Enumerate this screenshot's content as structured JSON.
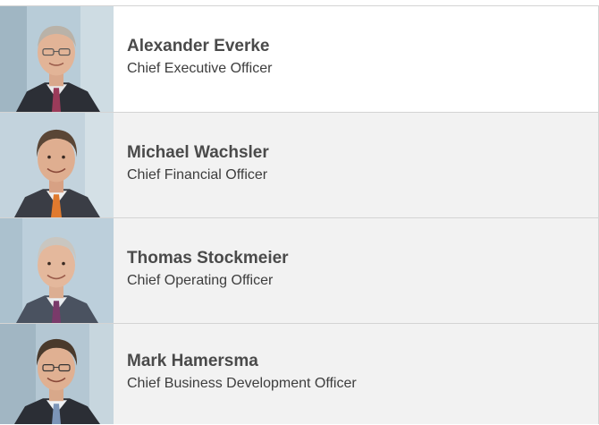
{
  "members": [
    {
      "name": "Alexander Everke",
      "title": "Chief Executive Officer",
      "photo_icon": "portrait-photo",
      "tie_color": "#9b3b5a",
      "hair_color": "#b9b2a8"
    },
    {
      "name": "Michael Wachsler",
      "title": "Chief Financial Officer",
      "photo_icon": "portrait-photo",
      "tie_color": "#e07a2e",
      "hair_color": "#5a4636"
    },
    {
      "name": "Thomas Stockmeier",
      "title": "Chief Operating Officer",
      "photo_icon": "portrait-photo",
      "tie_color": "#7a3a6a",
      "hair_color": "#c9c6c0"
    },
    {
      "name": "Mark Hamersma",
      "title": "Chief Business Development Officer",
      "photo_icon": "portrait-photo",
      "tie_color": "#7c95b8",
      "hair_color": "#4a3a2c"
    }
  ]
}
